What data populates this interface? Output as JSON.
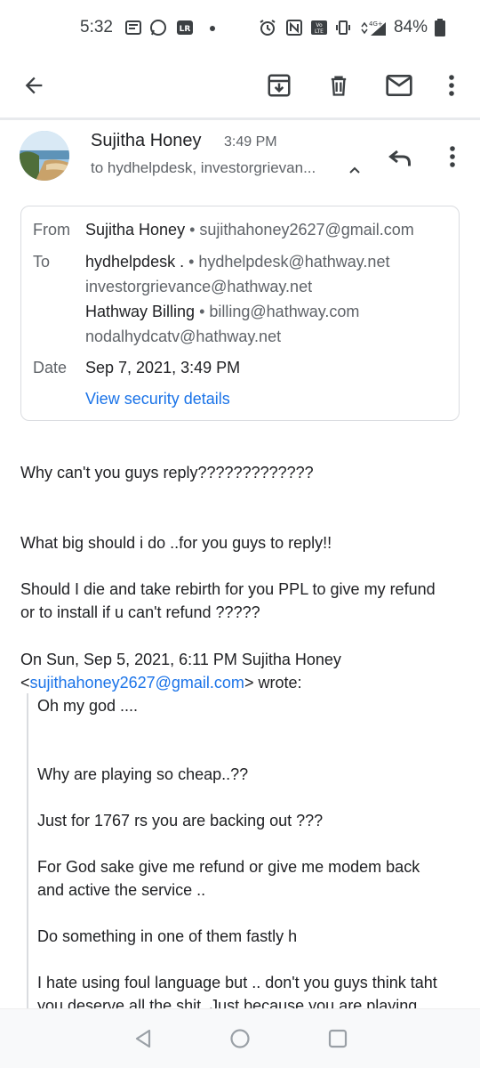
{
  "status_bar": {
    "time": "5:32",
    "battery": "84%",
    "icons": [
      "news-icon",
      "whatsapp-icon",
      "lr-icon",
      "dot-icon",
      "alarm-icon",
      "nfc-icon",
      "volte-icon",
      "vibrate-icon",
      "4g-signal-icon",
      "battery-icon"
    ]
  },
  "toolbar": {
    "icons": [
      "back-arrow-icon",
      "archive-icon",
      "delete-icon",
      "mark-unread-icon",
      "more-vert-icon"
    ]
  },
  "email": {
    "sender_name": "Sujitha Honey",
    "time": "3:49 PM",
    "recipients_summary": "to hydhelpdesk, investorgrievan...",
    "details": {
      "from_label": "From",
      "from_name": "Sujitha Honey",
      "from_email": " • sujithahoney2627@gmail.com",
      "to_label": "To",
      "to_1_name": "hydhelpdesk .",
      "to_1_email": " • hydhelpdesk@hathway.net",
      "to_2": "investorgrievance@hathway.net",
      "to_3_name": "Hathway Billing",
      "to_3_email": " • billing@hathway.com",
      "to_4": "nodalhydcatv@hathway.net",
      "date_label": "Date",
      "date_value": "Sep 7, 2021, 3:49 PM",
      "security_link": "View security details"
    },
    "body": {
      "line1": "Why can't you guys reply?????????????",
      "line2": "What big should i  do ..for you guys to reply!!",
      "line3": "Should I die and take rebirth for you PPL to give my refund",
      "line4": "or to install if u can't refund ?????",
      "quote_intro": "On Sun, Sep 5, 2021, 6:11 PM Sujitha Honey",
      "quote_lt": "<",
      "quote_email": "sujithahoney2627@gmail.com",
      "quote_wrote": "> wrote:"
    },
    "quoted": {
      "q1": "Oh my god ....",
      "q2": "Why are playing so cheap..??",
      "q3": "Just for 1767 rs you are backing out ???",
      "q4": "For God sake give me refund or give me modem back",
      "q5": "and active the service ..",
      "q6": "Do something in one of them fastly h",
      "q7": "I hate using foul language but .. don't you guys think taht",
      "q8": "you deserve all the shit .Just because you are playing"
    }
  },
  "nav_bar": {
    "icons": [
      "nav-back-icon",
      "nav-home-icon",
      "nav-recents-icon"
    ]
  },
  "colors": {
    "link": "#1a73e8",
    "text": "#202124",
    "muted": "#5f6368",
    "border": "#dadce0"
  }
}
